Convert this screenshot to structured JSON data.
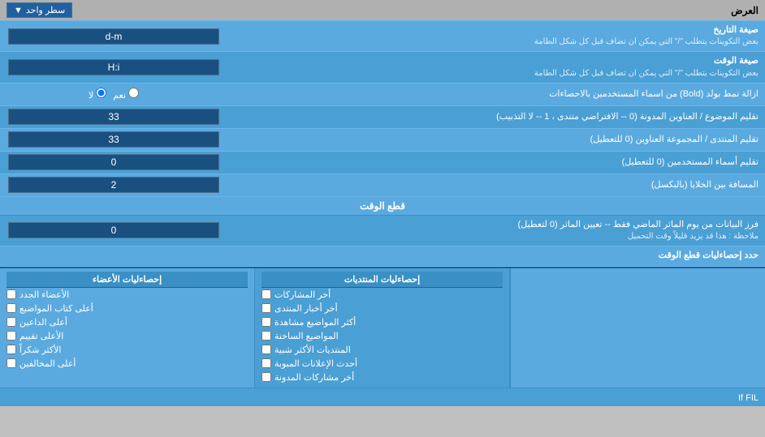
{
  "header": {
    "label": "العرض",
    "dropdown_label": "سطر واحد",
    "dropdown_arrow": "▼"
  },
  "date_format": {
    "label": "صيغة التاريخ",
    "sublabel": "بعض التكوينات يتطلب \"/\" التي يمكن ان تضاف قبل كل شكل الطامة",
    "value": "d-m"
  },
  "time_format": {
    "label": "صيغة الوقت",
    "sublabel": "بعض التكوينات يتطلب \"/\" التي يمكن ان تضاف قبل كل شكل الطامة",
    "value": "H:i"
  },
  "bold_remove": {
    "label": "ازالة نمط بولد (Bold) من اسماء المستخدمين بالاحصاءات",
    "radio_yes": "نعم",
    "radio_no": "لا",
    "default": "لا"
  },
  "topic_titles": {
    "label": "تقليم الموضوع / العناوين المدونة (0 -- الافتراضي متندى ، 1 -- لا التذبيب)",
    "value": "33"
  },
  "forum_titles": {
    "label": "تقليم المنتدى / المجموعة العناوين (0 للتعطيل)",
    "value": "33"
  },
  "user_names": {
    "label": "تقليم أسماء المستخدمين (0 للتعطيل)",
    "value": "0"
  },
  "space_between": {
    "label": "المسافة بين الخلايا (بالبكسل)",
    "value": "2"
  },
  "cutoff_section": {
    "label": "قطع الوقت"
  },
  "fetch_data": {
    "label": "فرز البيانات من يوم الماثر الماضي فقط -- تعيين الماثر (0 لتعطيل)",
    "note": "ملاحظة : هذا قد يزيد قليلاً وقت التحميل",
    "value": "0"
  },
  "limit_stats": {
    "label": "حدد إحصاءليات قطع الوقت"
  },
  "checkboxes": {
    "col1_header": "إحصاءليات المنتديات",
    "col2_header": "إحصاءليات الأعضاء",
    "col1_items": [
      "أخر المشاركات",
      "أخر أخبار المنتدى",
      "أكثر المواضيع مشاهدة",
      "المواضيع الساخنة",
      "المنتديات الأكثر شبية",
      "أحدث الإعلانات المبوبة",
      "أخر مشاركات المدونة"
    ],
    "col2_items": [
      "الأعضاء الجدد",
      "أعلى كتاب المواضيع",
      "أعلى الداعين",
      "الأعلى تقييم",
      "الأكثر شكراً",
      "أعلى المخالفين"
    ]
  }
}
